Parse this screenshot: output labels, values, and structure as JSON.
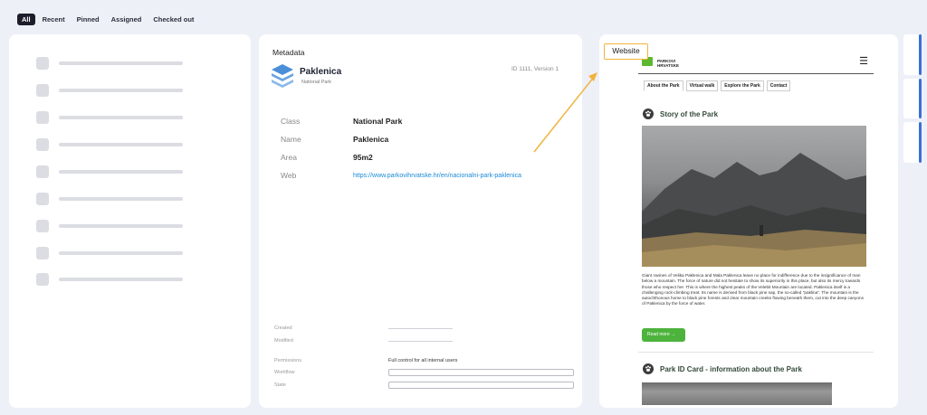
{
  "tabs": [
    {
      "label": "All",
      "active": true
    },
    {
      "label": "Recent",
      "active": false
    },
    {
      "label": "Pinned",
      "active": false
    },
    {
      "label": "Assigned",
      "active": false
    },
    {
      "label": "Checked out",
      "active": false
    }
  ],
  "metadata": {
    "title": "Metadata",
    "park": {
      "name": "Paklenica",
      "type": "National Park",
      "id": "ID 1111, Version 1"
    },
    "properties": [
      {
        "key": "Class",
        "value": "National Park"
      },
      {
        "key": "Name",
        "value": "Paklenica"
      },
      {
        "key": "Area",
        "value": "95m2"
      },
      {
        "key": "Web",
        "value": "https://www.parkovihrvatske.hr/en/nacionalni-park-paklenica"
      }
    ],
    "footer": {
      "created_label": "Created",
      "modified_label": "Modified",
      "permissions_label": "Permissions",
      "permissions_value": "Full control for all internal users",
      "workflow_label": "Workflow",
      "state_label": "State"
    }
  },
  "website": {
    "label": "Website",
    "logo_text": "PARKOVI HRVATSKE",
    "menu_icon": "hamburger-icon",
    "nav_tabs": [
      "About the Park",
      "Virtual walk",
      "Explore the Park",
      "Contact"
    ],
    "section1_title": "Story of the Park",
    "paragraph": "Giant ravines of Velika Paklenica and Mala Paklenica leave no place for indifference due to the insignificance of man below a mountain. The force of nature did not hesitate to show its superiority in this place, but also its mercy towards those who respect her. This is where the highest peaks of the Velebit Mountain are located. Paklenica itself is a challenging rock-climbing treat. Its name is derived from black pine sap, the so-called \"paklina\". The mountain is the autochthonous home to black pine forests and clear mountain creeks flowing beneath them, cut into the deep canyons of Paklenica by the force of water.",
    "read_more": "Read more",
    "section2_title": "Park ID Card - information about the Park"
  },
  "colors": {
    "accent_blue": "#3a6fd8",
    "link_blue": "#1a8ad8",
    "highlight_orange": "#f0b43c",
    "park_green": "#4db33d",
    "logo_blue": "#4a8fd8"
  }
}
